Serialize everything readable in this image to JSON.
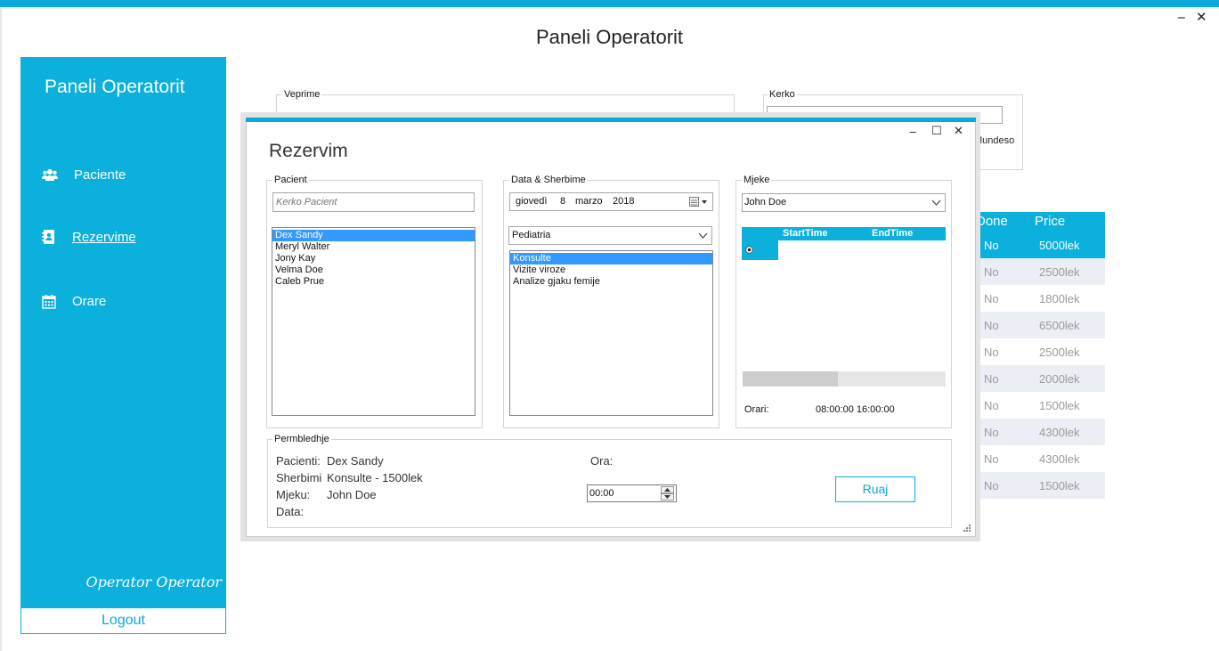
{
  "window": {
    "title": "Paneli Operatorit",
    "min_glyph": "‒",
    "close_glyph": "✕"
  },
  "sidebar": {
    "title": "Paneli Operatorit",
    "items": [
      {
        "label": "Paciente",
        "icon": "users-icon"
      },
      {
        "label": "Rezervime",
        "icon": "address-book-icon"
      },
      {
        "label": "Orare",
        "icon": "calendar-icon"
      }
    ],
    "operator": "Operator Operator",
    "logout": "Logout"
  },
  "background": {
    "veprime_label": "Veprime",
    "kerko_label": "Kerko",
    "mundeso_text": "Mundeso",
    "table": {
      "headers": [
        "Done",
        "Price"
      ],
      "rows": [
        [
          "No",
          "5000lek"
        ],
        [
          "No",
          "2500lek"
        ],
        [
          "No",
          "1800lek"
        ],
        [
          "No",
          "6500lek"
        ],
        [
          "No",
          "2500lek"
        ],
        [
          "No",
          "2000lek"
        ],
        [
          "No",
          "1500lek"
        ],
        [
          "No",
          "4300lek"
        ],
        [
          "No",
          "4300lek"
        ],
        [
          "No",
          "1500lek"
        ]
      ]
    }
  },
  "dialog": {
    "title": "Rezervim",
    "controls": {
      "min": "‒",
      "max": "☐",
      "close": "✕"
    },
    "pacient": {
      "group_label": "Pacient",
      "search_placeholder": "Kerko Pacient",
      "patients": [
        "Dex Sandy",
        "Meryl Walter",
        "Jony Kay",
        "Velma Doe",
        "Caleb Prue"
      ],
      "selected_index": 0
    },
    "data_sherbime": {
      "group_label": "Data & Sherbime",
      "date": {
        "weekday": "giovedì",
        "day": "8",
        "month": "marzo",
        "year": "2018"
      },
      "department": "Pediatria",
      "services": [
        "Konsulte",
        "Vizite viroze",
        "Analize gjaku femije"
      ],
      "selected_index": 0
    },
    "mjeke": {
      "group_label": "Mjeke",
      "doctor": "John Doe",
      "grid_headers": [
        "StartTime",
        "EndTime"
      ],
      "orari_label": "Orari:",
      "orari_value": "08:00:00 16:00:00"
    },
    "permbledhje": {
      "group_label": "Permbledhje",
      "pacienti_label": "Pacienti:",
      "pacienti_value": "Dex Sandy",
      "sherbimi_label": "Sherbimi",
      "sherbimi_value": "Konsulte - 1500lek",
      "mjeku_label": "Mjeku:",
      "mjeku_value": "John Doe",
      "data_label": "Data:",
      "ora_label": "Ora:",
      "time_value": "00:00",
      "save_button": "Ruaj"
    }
  },
  "colors": {
    "accent": "#0bb0dd",
    "selection": "#3399ff"
  }
}
